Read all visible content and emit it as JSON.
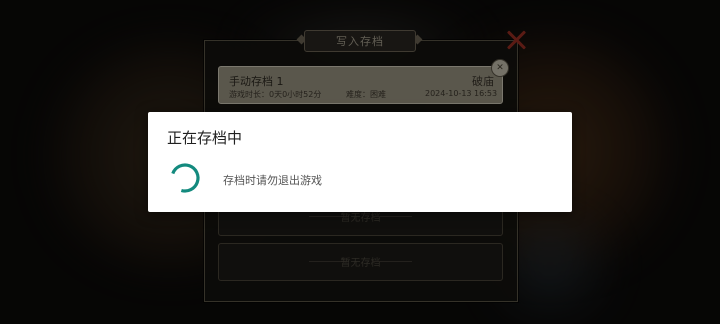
{
  "save_dialog": {
    "title": "写入存档",
    "slots": [
      {
        "name": "手动存档 1",
        "difficulty_tag": "破庙",
        "playtime": "游戏时长：0天0小时52分",
        "difficulty": "难度：困难",
        "timestamp": "2024-10-13 16:53",
        "delete_glyph": "✕"
      },
      {
        "empty_label": "暂无存档"
      },
      {
        "empty_label": "暂无存档"
      }
    ]
  },
  "modal": {
    "title": "正在存档中",
    "message": "存档时请勿退出游戏",
    "spinner_color": "#138a7e"
  },
  "colors": {
    "close_icon": "#9b2f24",
    "selected_slot_bg": "#9c9684"
  }
}
